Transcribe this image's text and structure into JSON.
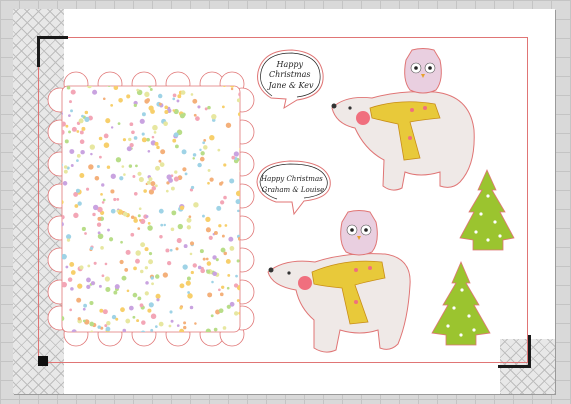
{
  "canvas": {
    "background": "#d9d9d9",
    "sheet_color": "#ffffff",
    "cut_line_color": "#e07575"
  },
  "cards": [
    {
      "greeting_lines": [
        "Happy",
        "Christmas",
        "Jane & Kev"
      ],
      "characters": [
        "owl",
        "polar-bear",
        "scarf"
      ]
    },
    {
      "greeting_lines": [
        "Happy Christmas",
        "Graham & Louise"
      ],
      "characters": [
        "owl",
        "polar-bear",
        "scarf"
      ]
    }
  ],
  "decorations": {
    "pattern_panel": "confetti-hearts",
    "trees": 2,
    "tree_color": "#9bc42f",
    "scarf_color": "#e8c93a",
    "bear_color": "#efe9e7",
    "owl_color": "#e9cfe0"
  },
  "icons": [
    "registration-mark",
    "crop-corner-mark",
    "cutting-mat-hatch"
  ]
}
